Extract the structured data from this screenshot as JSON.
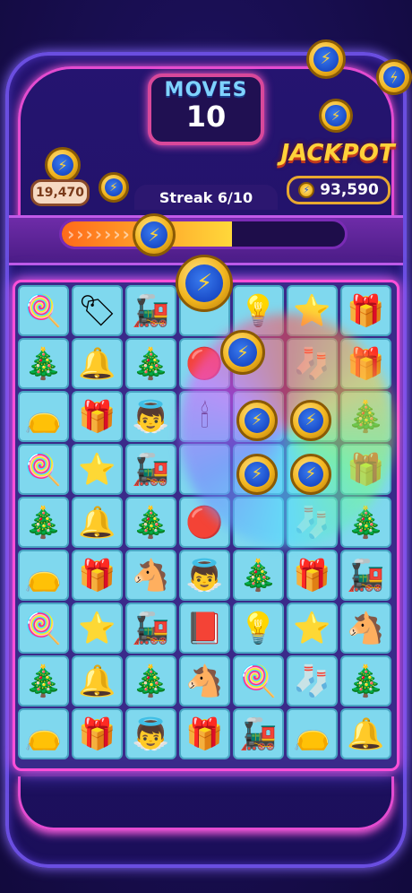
{
  "hud": {
    "moves_label": "MOVES",
    "moves_value": "10",
    "balance": "19,470",
    "jackpot_title": "JACKPOT",
    "jackpot_amount": "93,590",
    "streak_label": "Streak 6/10",
    "streak_current": 6,
    "streak_total": 10,
    "coin_symbol": "⚡"
  },
  "colors": {
    "tile_bg": "#7fd8ee",
    "frame_glow": "#ff4fd8",
    "streak_fill": "#ffa22a",
    "gold": "#f2b51e"
  },
  "board": {
    "rows": [
      [
        "candy-cane",
        "gift-tag",
        "toy-train",
        "",
        "light-string",
        "star",
        "wrapping-paper"
      ],
      [
        "wreath",
        "bells",
        "christmas-tree",
        "ornament",
        "",
        "stocking",
        "gift-box"
      ],
      [
        "santa-sack",
        "gift-box",
        "angel",
        "candle",
        "",
        "",
        "wreath"
      ],
      [
        "candy-cane",
        "star",
        "toy-train",
        "",
        "",
        "",
        "wrapping-paper"
      ],
      [
        "wreath",
        "bells",
        "christmas-tree",
        "ornament",
        "",
        "stocking",
        "christmas-tree"
      ],
      [
        "santa-sack",
        "gift-box",
        "rocking-horse",
        "angel",
        "wreath",
        "gift-box",
        "toy-train"
      ],
      [
        "candy-cane",
        "star",
        "toy-train",
        "storybook",
        "light-string",
        "star",
        "rocking-horse"
      ],
      [
        "wreath",
        "bells",
        "christmas-tree",
        "rocking-horse",
        "candy-cane",
        "stocking",
        "wreath"
      ],
      [
        "santa-sack",
        "gift-box",
        "angel",
        "gift-box",
        "toy-train",
        "santa-sack",
        "bells"
      ]
    ]
  }
}
